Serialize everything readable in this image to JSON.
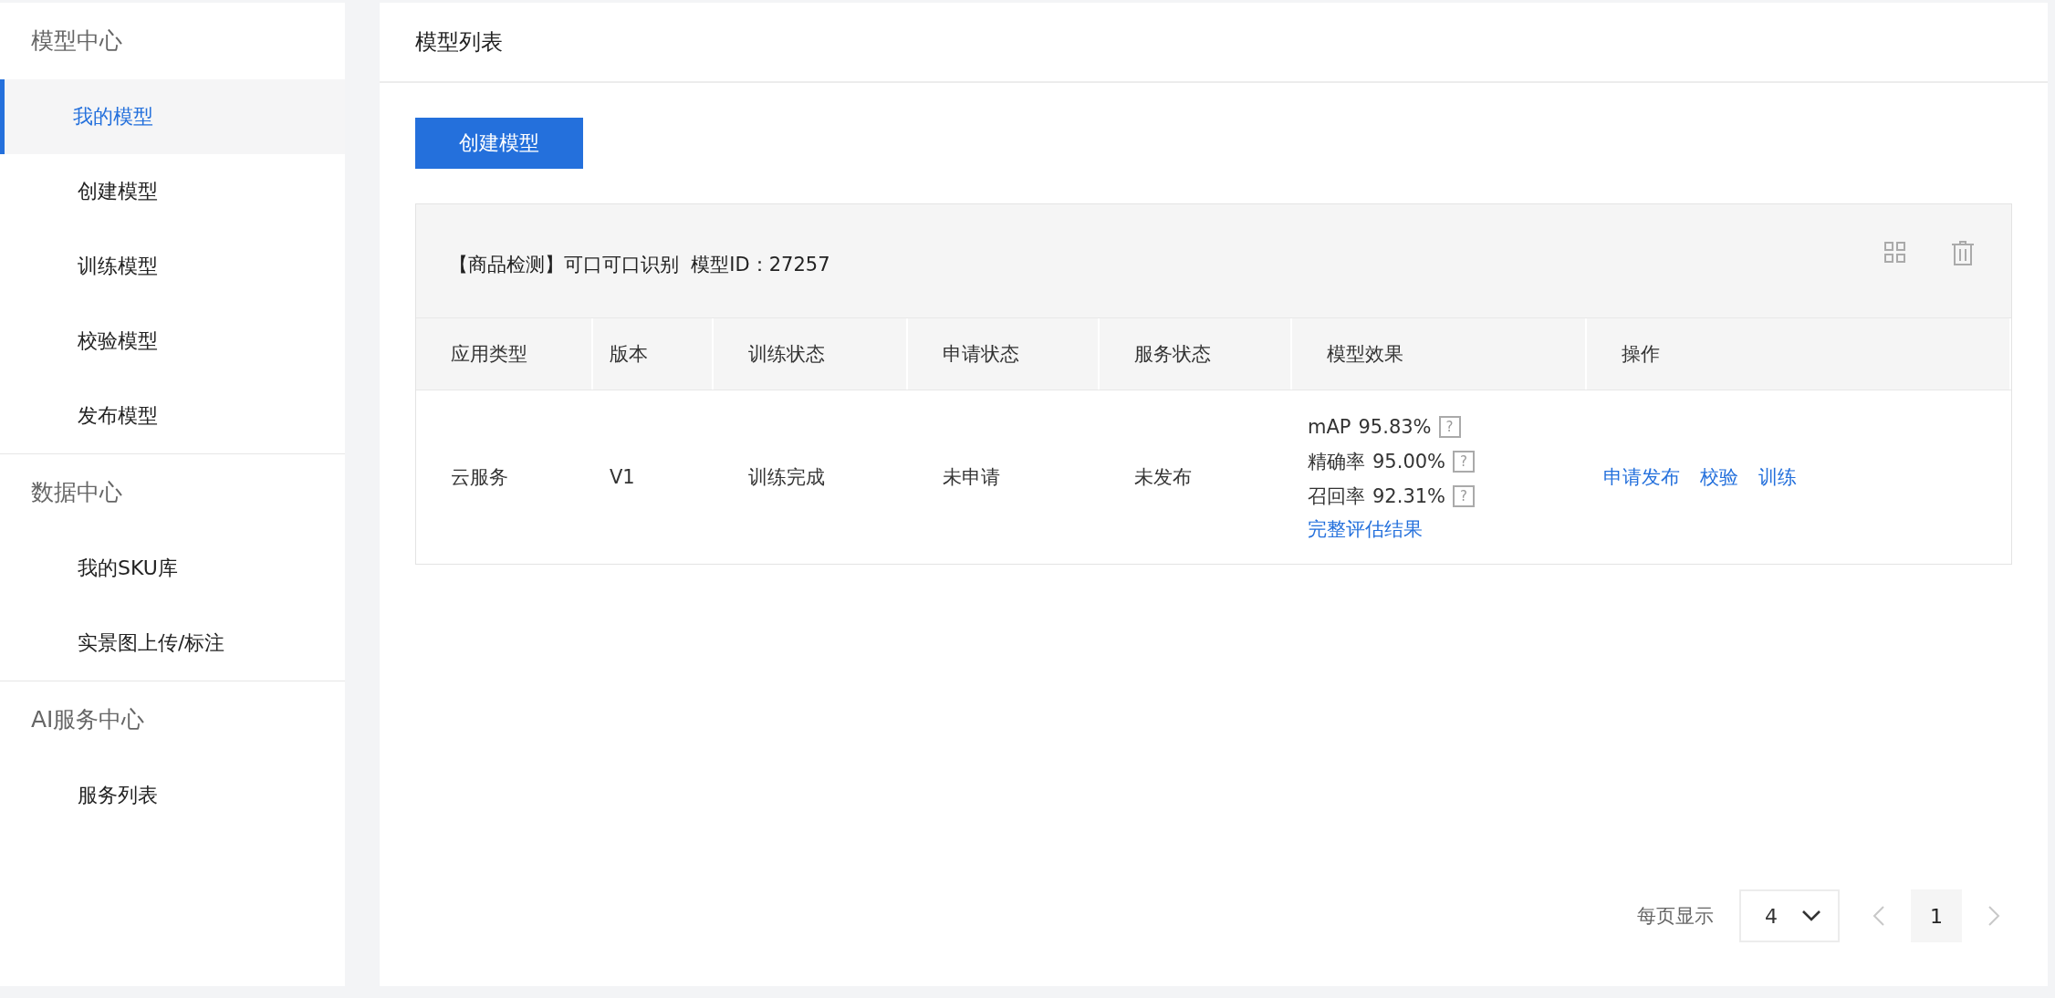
{
  "sidebar": {
    "groups": [
      {
        "title": "模型中心",
        "items": [
          {
            "label": "我的模型",
            "selected": true
          },
          {
            "label": "创建模型",
            "selected": false
          },
          {
            "label": "训练模型",
            "selected": false
          },
          {
            "label": "校验模型",
            "selected": false
          },
          {
            "label": "发布模型",
            "selected": false
          }
        ]
      },
      {
        "title": "数据中心",
        "items": [
          {
            "label": "我的SKU库",
            "selected": false
          },
          {
            "label": "实景图上传/标注",
            "selected": false
          }
        ]
      },
      {
        "title": "AI服务中心",
        "items": [
          {
            "label": "服务列表",
            "selected": false
          }
        ]
      }
    ]
  },
  "page": {
    "title": "模型列表",
    "create_button": "创建模型"
  },
  "model_card": {
    "title": "【商品检测】可口可口识别  模型ID：27257",
    "table": {
      "columns": [
        "应用类型",
        "版本",
        "训练状态",
        "申请状态",
        "服务状态",
        "模型效果",
        "操作"
      ],
      "rows": [
        {
          "app_type": "云服务",
          "version": "V1",
          "train_status": "训练完成",
          "apply_status": "未申请",
          "service_status": "未发布",
          "metrics": [
            {
              "label": "mAP",
              "value": "95.83%",
              "help": "?"
            },
            {
              "label": "精确率",
              "value": "95.00%",
              "help": "?"
            },
            {
              "label": "召回率",
              "value": "92.31%",
              "help": "?"
            }
          ],
          "metrics_link": "完整评估结果",
          "actions": [
            "申请发布",
            "校验",
            "训练"
          ]
        }
      ]
    }
  },
  "pagination": {
    "label": "每页显示",
    "page_size": "4",
    "prev_disabled": true,
    "next_disabled": true,
    "pages": [
      {
        "label": "1",
        "selected": true
      }
    ]
  }
}
